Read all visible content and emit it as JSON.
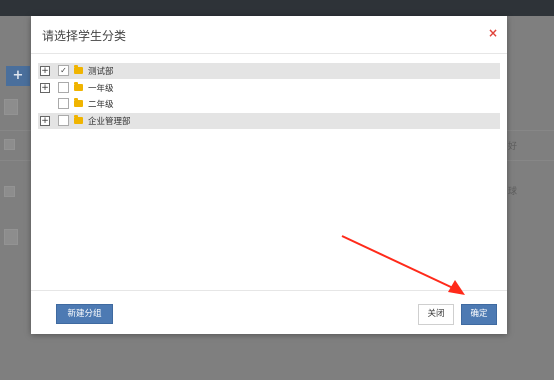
{
  "background": {
    "col_suffix": "好",
    "row_suffix": "球"
  },
  "dialog": {
    "title": "请选择学生分类",
    "close_glyph": "×",
    "tree": [
      {
        "label": "测试部",
        "expandable": true,
        "checked": true,
        "check_glyph": "✓"
      },
      {
        "label": "一年级",
        "expandable": true,
        "checked": false,
        "check_glyph": ""
      },
      {
        "label": "二年级",
        "expandable": false,
        "checked": false,
        "check_glyph": ""
      },
      {
        "label": "企业管理部",
        "expandable": true,
        "checked": false,
        "check_glyph": ""
      }
    ],
    "expander_glyph": "+",
    "footer": {
      "new_group_label": "新建分组",
      "close_label": "关闭",
      "confirm_label": "确定"
    }
  },
  "colors": {
    "primary": "#4d7ab3",
    "close_x": "#e0433b",
    "folder": "#f0b400",
    "annotation_arrow": "#ff2a1a"
  }
}
